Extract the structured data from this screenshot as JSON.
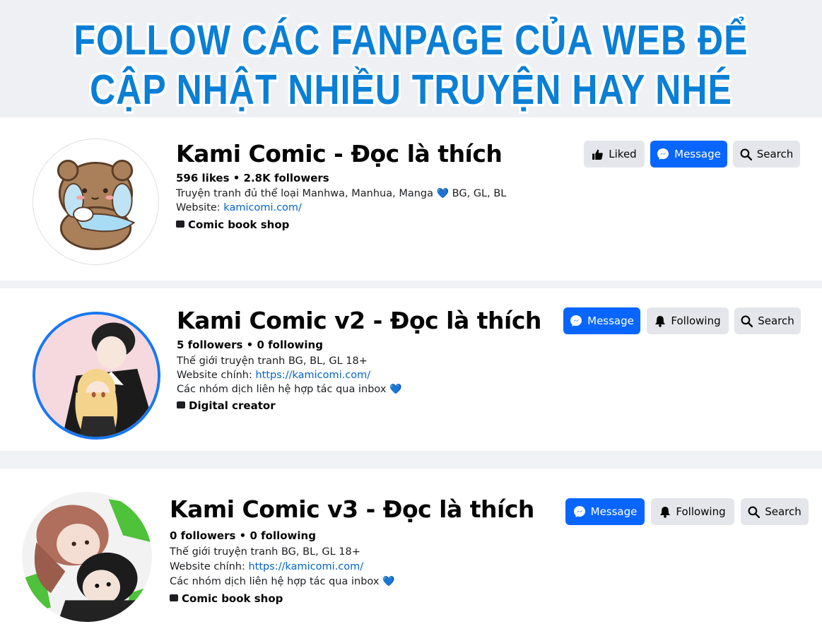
{
  "banner": {
    "line1": "Follow các fanpage của web để",
    "line2": "cập nhật nhiều truyện hay nhé"
  },
  "pages": [
    {
      "name": "Kami Comic - Đọc là thích",
      "stats": "596 likes • 2.8K followers",
      "line1": "Truyện tranh đủ thể loại Manhwa, Manhua, Manga",
      "line1_suffix": "BG, GL, BL",
      "website_label": "Website: ",
      "website_link": "kamicomi.com/",
      "category": "Comic book shop",
      "buttons": {
        "liked": "Liked",
        "message": "Message",
        "search": "Search"
      }
    },
    {
      "name": "Kami Comic v2 - Đọc là thích",
      "stats": "5 followers • 0 following",
      "line1": "Thế giới truyện tranh BG, BL, GL 18+",
      "website_label": "Website chính: ",
      "website_link": "https://kamicomi.com/",
      "line3": "Các nhóm dịch liên hệ hợp tác qua inbox",
      "category": "Digital creator",
      "buttons": {
        "message": "Message",
        "following": "Following",
        "search": "Search"
      }
    },
    {
      "name": "Kami Comic v3 - Đọc là thích",
      "stats": "0 followers • 0 following",
      "line1": "Thế giới truyện tranh BG, BL, GL 18+",
      "website_label": "Website chính: ",
      "website_link": "https://kamicomi.com/",
      "line3": "Các nhóm dịch liên hệ hợp tác qua inbox",
      "category": "Comic book shop",
      "buttons": {
        "message": "Message",
        "following": "Following",
        "search": "Search"
      }
    }
  ],
  "colors": {
    "accent_blue": "#0866ff",
    "link_blue": "#0064d1",
    "banner_blue": "#0a7fd6",
    "button_grey": "#e4e6eb"
  },
  "icons": [
    "thumbs-up-icon",
    "messenger-icon",
    "search-icon",
    "bell-icon",
    "category-icon",
    "heart-icon"
  ]
}
